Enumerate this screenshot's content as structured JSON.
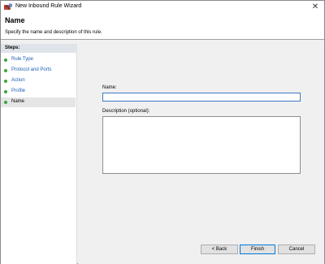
{
  "window": {
    "title": "New Inbound Rule Wizard",
    "close_glyph": "✕"
  },
  "header": {
    "title": "Name",
    "description": "Specify the name and description of this rule."
  },
  "steps": {
    "heading": "Steps:",
    "items": [
      {
        "label": "Rule Type",
        "state": "done"
      },
      {
        "label": "Protocol and Ports",
        "state": "done"
      },
      {
        "label": "Action",
        "state": "done"
      },
      {
        "label": "Profile",
        "state": "done"
      },
      {
        "label": "Name",
        "state": "current"
      }
    ]
  },
  "form": {
    "name_label": "Name:",
    "name_value": "",
    "description_label": "Description (optional):",
    "description_value": ""
  },
  "buttons": {
    "back": "< Back",
    "finish": "Finish",
    "cancel": "Cancel"
  },
  "colors": {
    "step_dot": "#3ba33b",
    "step_link": "#1a5fb4",
    "focus_border": "#3b79c6"
  },
  "icons": {
    "app": "firewall-wizard-icon",
    "close": "close-icon",
    "step_done": "green-dot-icon"
  }
}
